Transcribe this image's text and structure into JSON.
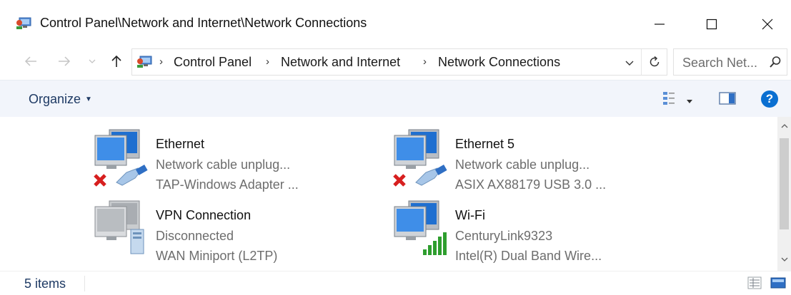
{
  "window": {
    "title": "Control Panel\\Network and Internet\\Network Connections",
    "controls": {
      "minimize_icon": "minimize-icon",
      "maximize_icon": "maximize-icon",
      "close_icon": "close-icon"
    }
  },
  "navigation": {
    "back_icon": "back-arrow-icon",
    "forward_icon": "forward-arrow-icon",
    "recent_icon": "chevron-down-icon",
    "up_icon": "up-arrow-icon",
    "breadcrumbs": [
      "Control Panel",
      "Network and Internet",
      "Network Connections"
    ],
    "history_dropdown_icon": "chevron-down-icon",
    "refresh_icon": "refresh-icon"
  },
  "search": {
    "placeholder": "Search Net...",
    "icon": "search-icon"
  },
  "toolbar": {
    "organize_label": "Organize",
    "view_options_icon": "change-view-icon",
    "preview_pane_icon": "preview-pane-icon",
    "help_icon": "help-icon",
    "help_label": "?"
  },
  "connections": [
    {
      "name": "Ethernet",
      "status": "Network cable unplug...",
      "adapter": "TAP-Windows Adapter ...",
      "icon": "ethernet-disconnected-icon"
    },
    {
      "name": "Ethernet 5",
      "status": "Network cable unplug...",
      "adapter": "ASIX AX88179 USB 3.0 ...",
      "icon": "ethernet-disconnected-icon"
    },
    {
      "name": "VPN Connection",
      "status": "Disconnected",
      "adapter": "WAN Miniport (L2TP)",
      "icon": "vpn-icon"
    },
    {
      "name": "Wi-Fi",
      "status": "CenturyLink9323",
      "adapter": "Intel(R) Dual Band Wire...",
      "icon": "wifi-signal-icon"
    }
  ],
  "status_bar": {
    "item_count": "5 items",
    "details_view_icon": "details-view-icon",
    "large_icons_view_icon": "large-icons-view-icon"
  },
  "colors": {
    "accent": "#1e3a64",
    "command_bar": "#f2f5fb",
    "help_blue": "#0a6fd1",
    "error_red": "#d71f1f",
    "signal_green": "#2e9e2e"
  }
}
